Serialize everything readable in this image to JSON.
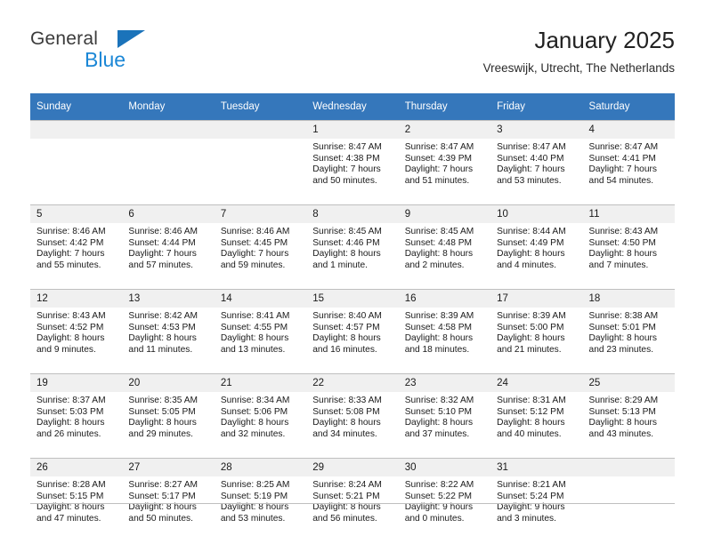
{
  "brand": {
    "name_top": "General",
    "name_bottom": "Blue",
    "triangle_color": "#1b73ba",
    "blue_color": "#1b87d6"
  },
  "header": {
    "title": "January 2025",
    "subtitle": "Vreeswijk, Utrecht, The Netherlands"
  },
  "theme": {
    "header_bg": "#3577bb",
    "daynum_bg": "#f0f0f0",
    "rule_color": "#bfbfbf"
  },
  "calendar": {
    "weekday_headers": [
      "Sunday",
      "Monday",
      "Tuesday",
      "Wednesday",
      "Thursday",
      "Friday",
      "Saturday"
    ],
    "weeks": [
      [
        {
          "day": "",
          "lines": [
            "",
            "",
            "",
            ""
          ]
        },
        {
          "day": "",
          "lines": [
            "",
            "",
            "",
            ""
          ]
        },
        {
          "day": "",
          "lines": [
            "",
            "",
            "",
            ""
          ]
        },
        {
          "day": "1",
          "lines": [
            "Sunrise: 8:47 AM",
            "Sunset: 4:38 PM",
            "Daylight: 7 hours",
            "and 50 minutes."
          ]
        },
        {
          "day": "2",
          "lines": [
            "Sunrise: 8:47 AM",
            "Sunset: 4:39 PM",
            "Daylight: 7 hours",
            "and 51 minutes."
          ]
        },
        {
          "day": "3",
          "lines": [
            "Sunrise: 8:47 AM",
            "Sunset: 4:40 PM",
            "Daylight: 7 hours",
            "and 53 minutes."
          ]
        },
        {
          "day": "4",
          "lines": [
            "Sunrise: 8:47 AM",
            "Sunset: 4:41 PM",
            "Daylight: 7 hours",
            "and 54 minutes."
          ]
        }
      ],
      [
        {
          "day": "5",
          "lines": [
            "Sunrise: 8:46 AM",
            "Sunset: 4:42 PM",
            "Daylight: 7 hours",
            "and 55 minutes."
          ]
        },
        {
          "day": "6",
          "lines": [
            "Sunrise: 8:46 AM",
            "Sunset: 4:44 PM",
            "Daylight: 7 hours",
            "and 57 minutes."
          ]
        },
        {
          "day": "7",
          "lines": [
            "Sunrise: 8:46 AM",
            "Sunset: 4:45 PM",
            "Daylight: 7 hours",
            "and 59 minutes."
          ]
        },
        {
          "day": "8",
          "lines": [
            "Sunrise: 8:45 AM",
            "Sunset: 4:46 PM",
            "Daylight: 8 hours",
            "and 1 minute."
          ]
        },
        {
          "day": "9",
          "lines": [
            "Sunrise: 8:45 AM",
            "Sunset: 4:48 PM",
            "Daylight: 8 hours",
            "and 2 minutes."
          ]
        },
        {
          "day": "10",
          "lines": [
            "Sunrise: 8:44 AM",
            "Sunset: 4:49 PM",
            "Daylight: 8 hours",
            "and 4 minutes."
          ]
        },
        {
          "day": "11",
          "lines": [
            "Sunrise: 8:43 AM",
            "Sunset: 4:50 PM",
            "Daylight: 8 hours",
            "and 7 minutes."
          ]
        }
      ],
      [
        {
          "day": "12",
          "lines": [
            "Sunrise: 8:43 AM",
            "Sunset: 4:52 PM",
            "Daylight: 8 hours",
            "and 9 minutes."
          ]
        },
        {
          "day": "13",
          "lines": [
            "Sunrise: 8:42 AM",
            "Sunset: 4:53 PM",
            "Daylight: 8 hours",
            "and 11 minutes."
          ]
        },
        {
          "day": "14",
          "lines": [
            "Sunrise: 8:41 AM",
            "Sunset: 4:55 PM",
            "Daylight: 8 hours",
            "and 13 minutes."
          ]
        },
        {
          "day": "15",
          "lines": [
            "Sunrise: 8:40 AM",
            "Sunset: 4:57 PM",
            "Daylight: 8 hours",
            "and 16 minutes."
          ]
        },
        {
          "day": "16",
          "lines": [
            "Sunrise: 8:39 AM",
            "Sunset: 4:58 PM",
            "Daylight: 8 hours",
            "and 18 minutes."
          ]
        },
        {
          "day": "17",
          "lines": [
            "Sunrise: 8:39 AM",
            "Sunset: 5:00 PM",
            "Daylight: 8 hours",
            "and 21 minutes."
          ]
        },
        {
          "day": "18",
          "lines": [
            "Sunrise: 8:38 AM",
            "Sunset: 5:01 PM",
            "Daylight: 8 hours",
            "and 23 minutes."
          ]
        }
      ],
      [
        {
          "day": "19",
          "lines": [
            "Sunrise: 8:37 AM",
            "Sunset: 5:03 PM",
            "Daylight: 8 hours",
            "and 26 minutes."
          ]
        },
        {
          "day": "20",
          "lines": [
            "Sunrise: 8:35 AM",
            "Sunset: 5:05 PM",
            "Daylight: 8 hours",
            "and 29 minutes."
          ]
        },
        {
          "day": "21",
          "lines": [
            "Sunrise: 8:34 AM",
            "Sunset: 5:06 PM",
            "Daylight: 8 hours",
            "and 32 minutes."
          ]
        },
        {
          "day": "22",
          "lines": [
            "Sunrise: 8:33 AM",
            "Sunset: 5:08 PM",
            "Daylight: 8 hours",
            "and 34 minutes."
          ]
        },
        {
          "day": "23",
          "lines": [
            "Sunrise: 8:32 AM",
            "Sunset: 5:10 PM",
            "Daylight: 8 hours",
            "and 37 minutes."
          ]
        },
        {
          "day": "24",
          "lines": [
            "Sunrise: 8:31 AM",
            "Sunset: 5:12 PM",
            "Daylight: 8 hours",
            "and 40 minutes."
          ]
        },
        {
          "day": "25",
          "lines": [
            "Sunrise: 8:29 AM",
            "Sunset: 5:13 PM",
            "Daylight: 8 hours",
            "and 43 minutes."
          ]
        }
      ],
      [
        {
          "day": "26",
          "lines": [
            "Sunrise: 8:28 AM",
            "Sunset: 5:15 PM",
            "Daylight: 8 hours",
            "and 47 minutes."
          ]
        },
        {
          "day": "27",
          "lines": [
            "Sunrise: 8:27 AM",
            "Sunset: 5:17 PM",
            "Daylight: 8 hours",
            "and 50 minutes."
          ]
        },
        {
          "day": "28",
          "lines": [
            "Sunrise: 8:25 AM",
            "Sunset: 5:19 PM",
            "Daylight: 8 hours",
            "and 53 minutes."
          ]
        },
        {
          "day": "29",
          "lines": [
            "Sunrise: 8:24 AM",
            "Sunset: 5:21 PM",
            "Daylight: 8 hours",
            "and 56 minutes."
          ]
        },
        {
          "day": "30",
          "lines": [
            "Sunrise: 8:22 AM",
            "Sunset: 5:22 PM",
            "Daylight: 9 hours",
            "and 0 minutes."
          ]
        },
        {
          "day": "31",
          "lines": [
            "Sunrise: 8:21 AM",
            "Sunset: 5:24 PM",
            "Daylight: 9 hours",
            "and 3 minutes."
          ]
        },
        {
          "day": "",
          "lines": [
            "",
            "",
            "",
            ""
          ]
        }
      ]
    ]
  }
}
